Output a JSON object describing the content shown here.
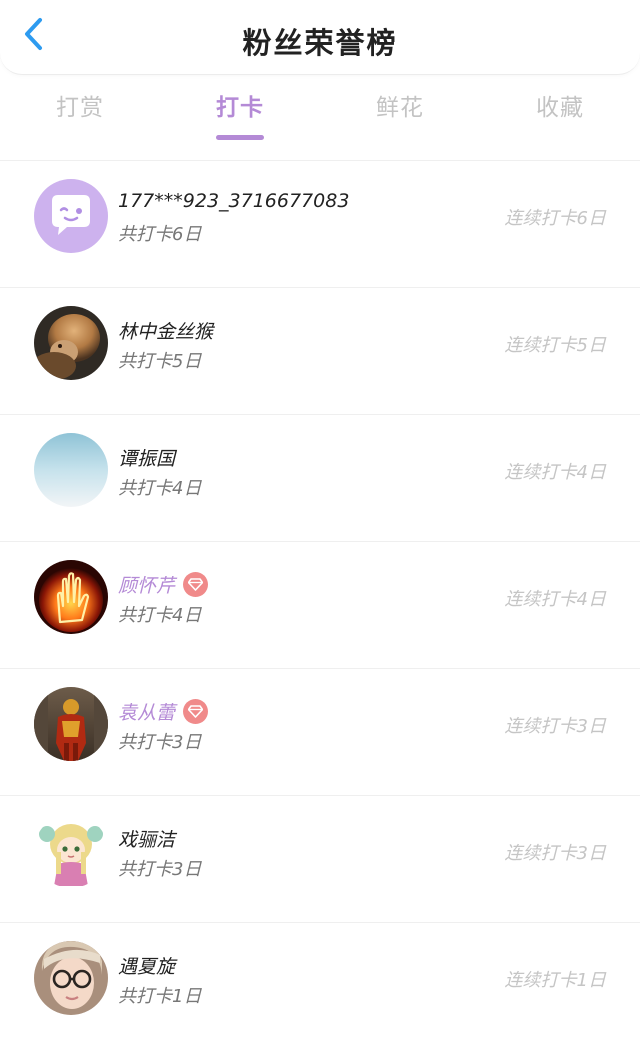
{
  "header": {
    "title": "粉丝荣誉榜",
    "back_icon": "chevron-left-icon",
    "accent": "#2d9bf0"
  },
  "tabs": [
    {
      "label": "打赏"
    },
    {
      "label": "打卡"
    },
    {
      "label": "鲜花"
    },
    {
      "label": "收藏"
    }
  ],
  "active_tab": 1,
  "colors": {
    "accent_purple": "#b48ad6",
    "badge_red": "#f08a8a",
    "muted": "#c5c5c5"
  },
  "fans": [
    {
      "name": "177***923_3716677083",
      "total": "共打卡6日",
      "streak": "连续打卡6日",
      "vip": false,
      "avatar": "purple-chat-bubble-avatar"
    },
    {
      "name": "林中金丝猴",
      "total": "共打卡5日",
      "streak": "连续打卡5日",
      "vip": false,
      "avatar": "monkey-photo-avatar"
    },
    {
      "name": "谭振国",
      "total": "共打卡4日",
      "streak": "连续打卡4日",
      "vip": false,
      "avatar": "sky-gradient-avatar"
    },
    {
      "name": "顾怀芹",
      "total": "共打卡4日",
      "streak": "连续打卡4日",
      "vip": true,
      "avatar": "fiery-hand-avatar"
    },
    {
      "name": "袁从蕾",
      "total": "共打卡3日",
      "streak": "连续打卡3日",
      "vip": true,
      "avatar": "armored-warrior-avatar"
    },
    {
      "name": "戏骊洁",
      "total": "共打卡3日",
      "streak": "连续打卡3日",
      "vip": false,
      "avatar": "anime-girl-avatar"
    },
    {
      "name": "遇夏旋",
      "total": "共打卡1日",
      "streak": "连续打卡1日",
      "vip": false,
      "avatar": "glasses-portrait-avatar"
    }
  ]
}
